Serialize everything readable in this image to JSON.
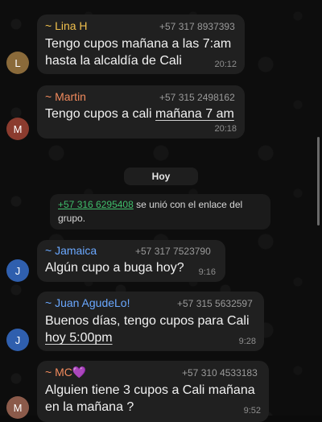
{
  "messages": [
    {
      "sender": "~ Lina H",
      "phone": "+57 317 8937393",
      "lines": [
        "Tengo cupos mañana a las 7:am",
        "hasta la alcaldía de Cali"
      ],
      "time": "20:12",
      "avatar": "L",
      "sender_color": "#f0c04d",
      "avatar_color": "#8a6a3a"
    },
    {
      "sender": "~ Martin",
      "phone": "+57 315 2498162",
      "line_prefix": "Tengo cupos a cali ",
      "line_link": "mañana 7 am",
      "time": "20:18",
      "avatar": "M",
      "sender_color": "#f08a5d",
      "avatar_color": "#8b3b2e"
    },
    {
      "sender": "~ Jamaica",
      "phone": "+57 317 7523790",
      "text": "Algún cupo a buga hoy?",
      "time": "9:16",
      "avatar": "J",
      "sender_color": "#6aa8ff",
      "avatar_color": "#2f5fae"
    },
    {
      "sender": "~ Juan AgudeLo!",
      "phone": "+57 315 5632597",
      "line1": "Buenos días, tengo cupos para Cali",
      "line2_link": "hoy 5:00pm",
      "time": "9:28",
      "avatar": "J",
      "sender_color": "#6aa8ff",
      "avatar_color": "#2f5fae"
    },
    {
      "sender": "~ MC",
      "sender_emoji": "💜",
      "phone": "+57 310 4533183",
      "lines": [
        "Alguien tiene 3 cupos a Cali mañana",
        "en la mañana ?"
      ],
      "time": "9:52",
      "avatar": "M",
      "sender_color": "#f08a5d",
      "avatar_color": "#8b5a4a"
    }
  ],
  "date_divider": "Hoy",
  "system_message": {
    "phone_link": "+57 316 6295408",
    "text_line1": " se unió con el enlace del",
    "text_line2": "grupo."
  }
}
